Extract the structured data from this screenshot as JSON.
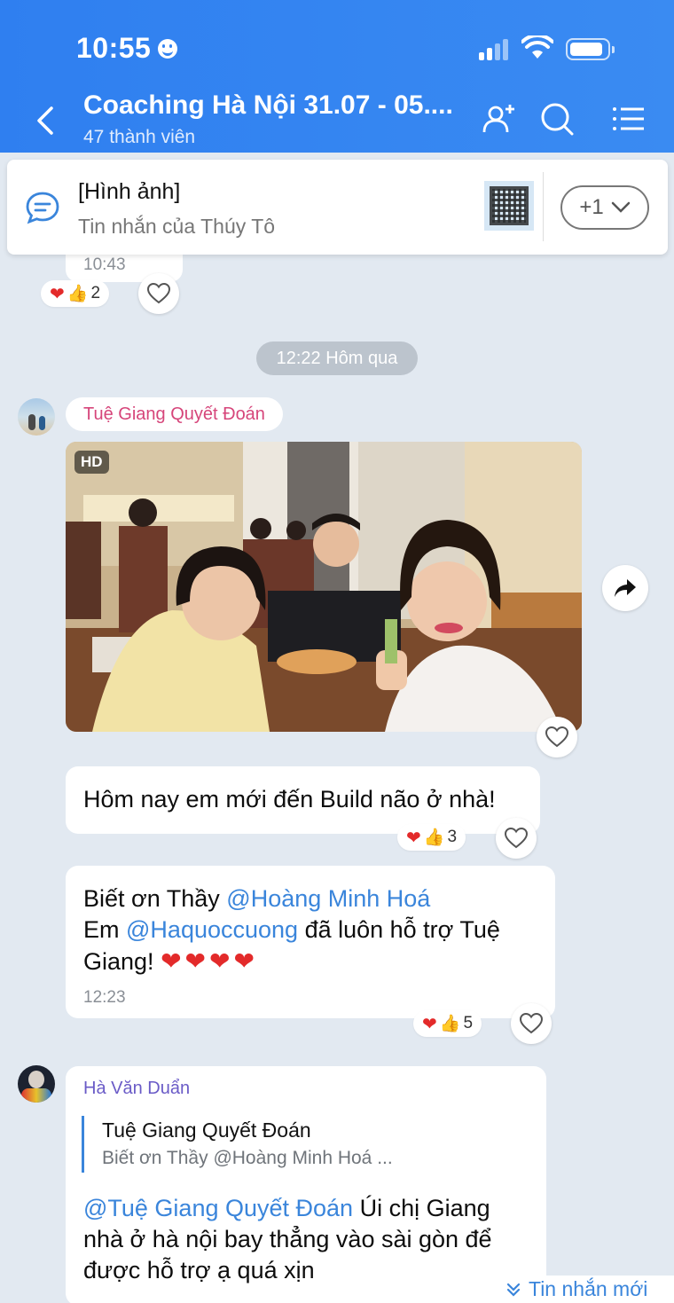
{
  "status_bar": {
    "time": "10:55"
  },
  "header": {
    "title": "Coaching Hà Nội 31.07 - 05....",
    "subtitle": "47 thành viên"
  },
  "pinned": {
    "title": "[Hình ảnh]",
    "subtitle": "Tin nhắn của Thúy Tô",
    "more_label": "+1"
  },
  "prev_message": {
    "time": "10:43",
    "reaction_count": "2"
  },
  "date_divider": "12:22 Hôm qua",
  "messages": [
    {
      "sender": "Tuệ Giang Quyết Đoán",
      "photo_badge": "HD",
      "text_1": "Hôm nay em mới đến Build não ở nhà!",
      "text_1_reaction_count": "3",
      "text_2_line1_prefix": "Biết ơn Thầy ",
      "text_2_mention1": "@Hoàng Minh Hoá",
      "text_2_line2_prefix": "Em ",
      "text_2_mention2": "@Haquoccuong",
      "text_2_line2_suffix": " đã luôn hỗ trợ Tuệ",
      "text_2_line3": "Giang! ",
      "text_2_hearts": "❤❤❤❤",
      "text_2_time": "12:23",
      "text_2_reaction_count": "5"
    },
    {
      "sender": "Hà Văn Duẩn",
      "quote_name": "Tuệ Giang Quyết Đoán",
      "quote_text": "Biết ơn Thầy @Hoàng Minh Hoá ...",
      "mention": "@Tuệ Giang Quyết Đoán",
      "text_line1_suffix": " Úi chị Giang",
      "text_line2": "nhà ở hà nội bay thẳng vào sài gòn để",
      "text_line3": "được hỗ trợ ạ quá xịn"
    }
  ],
  "new_messages_label": "Tin nhắn mới",
  "colors": {
    "header_blue": "#3483f1",
    "background": "#e2e9f1",
    "mention_blue": "#3a85db",
    "sender_pink": "#d6457a",
    "sender_purple": "#6a5bc7"
  },
  "icons": [
    "back-arrow-icon",
    "add-member-icon",
    "search-icon",
    "menu-icon",
    "chat-bubble-icon",
    "chevron-down-icon",
    "heart-icon",
    "thumbs-up-icon",
    "forward-icon"
  ]
}
